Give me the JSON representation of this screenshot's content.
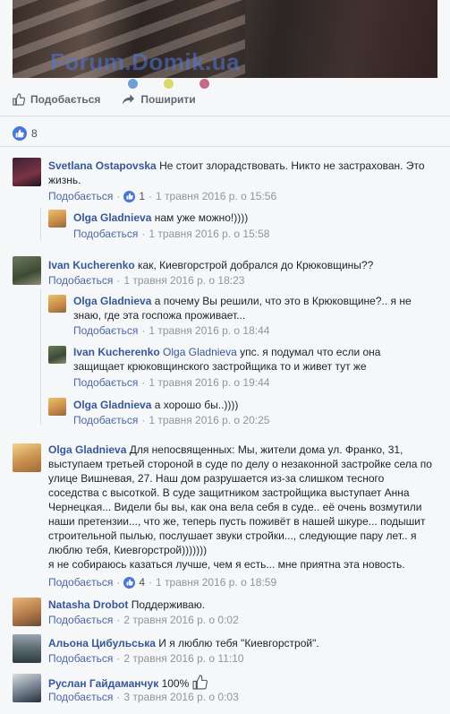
{
  "post": {
    "watermark": "Forum.Domik.ua",
    "carousel_dots": [
      "#6d9ed6",
      "#d9d86b",
      "#c9678d"
    ],
    "actions": {
      "like": "Подобається",
      "share": "Поширити"
    },
    "like_count": "8"
  },
  "ui": {
    "like": "Подобається",
    "dot": "·"
  },
  "comments": [
    {
      "name": "Svetlana Ostapovska",
      "text": "Не стоит злорадствовать. Никто не застрахован. Это жизнь.",
      "likes": "1",
      "time": "1 травня 2016 р. о 15:56"
    },
    {
      "name": "Olga Gladnieva",
      "text": "нам уже можно!))))",
      "time": "1 травня 2016 р. о 15:58"
    },
    {
      "name": "Ivan Kucherenko",
      "text": "как, Киевгорстрой добрался до Крюковщины??",
      "time": "1 травня 2016 р. о 18:23"
    },
    {
      "name": "Olga Gladnieva",
      "text": "а почему Вы решили, что это в Крюковщине?.. я не знаю, где эта госпожа проживает...",
      "time": "1 травня 2016 р. о 18:44"
    },
    {
      "name": "Ivan Kucherenko",
      "tag": "Olga Gladnieva",
      "text": "упс. я подумал что если она защищает крюковщинского застройщика то и живет тут же",
      "time": "1 травня 2016 р. о 19:44"
    },
    {
      "name": "Olga Gladnieva",
      "text": "а хорошо бы..))))",
      "time": "1 травня 2016 р. о 20:25"
    },
    {
      "name": "Olga Gladnieva",
      "text": "Для непосвященных: Мы, жители дома ул. Франко, 31, выступаем третьей стороной в суде по делу о незаконной застройке села по улице Вишневая, 27. Наш дом разрушается из-за слишком тесного соседства с высоткой. В суде защитником застройщика выступает Анна Чернецкая... Видели бы вы, как она вела себя в суде.. её очень возмутили наши претензии..., что же, теперь пусть поживёт в нашей шкуре... подышит строительной пылью, послушает звуки стройки..., следующие пару лет.. я люблю тебя, Киевгорстрой)))))))",
      "text2": "я не собираюсь казаться лучше, чем я есть... мне приятна эта новость.",
      "likes": "4",
      "time": "1 травня 2016 р. о 18:59"
    },
    {
      "name": "Natasha Drobot",
      "text": "Поддерживаю.",
      "time": "2 травня 2016 р. о 0:02"
    },
    {
      "name": "Альона Цибульська",
      "text": "И я люблю тебя \"Киевгорстрой\".",
      "time": "2 травня 2016 р. о 11:10"
    },
    {
      "name": "Руслан Гайдаманчук",
      "text": "100%",
      "time": "3 травня 2016 р. о 0:03"
    }
  ]
}
